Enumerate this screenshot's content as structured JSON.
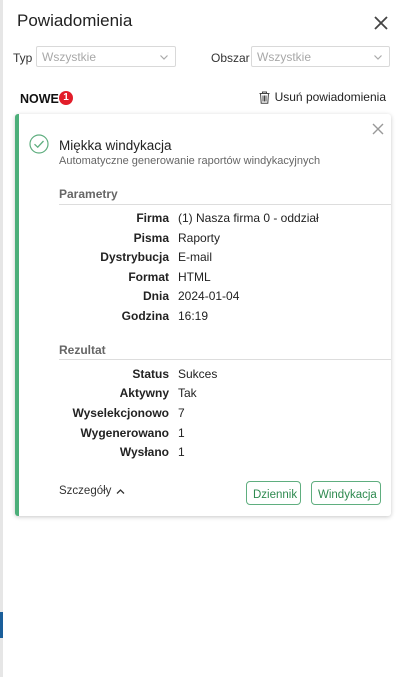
{
  "header": {
    "title": "Powiadomienia"
  },
  "filters": {
    "type_label": "Typ",
    "type_value": "Wszystkie",
    "area_label": "Obszar",
    "area_value": "Wszystkie"
  },
  "section": {
    "label": "NOWE",
    "count": "1",
    "clear_all_label": "Usuń powiadomienia"
  },
  "notification": {
    "title": "Miękka windykacja",
    "subtitle": "Automatyczne generowanie raportów windykacyjnych",
    "params_title": "Parametry",
    "params": [
      {
        "key": "Firma",
        "value": "(1) Nasza firma 0 - oddział"
      },
      {
        "key": "Pisma",
        "value": "Raporty"
      },
      {
        "key": "Dystrybucja",
        "value": "E-mail"
      },
      {
        "key": "Format",
        "value": "HTML"
      },
      {
        "key": "Dnia",
        "value": "2024-01-04"
      },
      {
        "key": "Godzina",
        "value": "16:19"
      }
    ],
    "result_title": "Rezultat",
    "results": [
      {
        "key": "Status",
        "value": "Sukces"
      },
      {
        "key": "Aktywny",
        "value": "Tak"
      },
      {
        "key": "Wyselekcjonowo",
        "value": "7"
      },
      {
        "key": "Wygenerowano",
        "value": "1"
      },
      {
        "key": "Wysłano",
        "value": "1"
      }
    ],
    "details_label": "Szczegóły",
    "journal_button": "Dziennik",
    "collection_button": "Windykacja",
    "accent_color": "#4caf7a"
  },
  "colors": {
    "badge": "#e21d2a",
    "button_text": "#2e8a4f"
  },
  "icons": [
    "close-icon",
    "chevron-down-icon",
    "trash-icon",
    "check-circle-icon",
    "chevron-up-icon"
  ]
}
